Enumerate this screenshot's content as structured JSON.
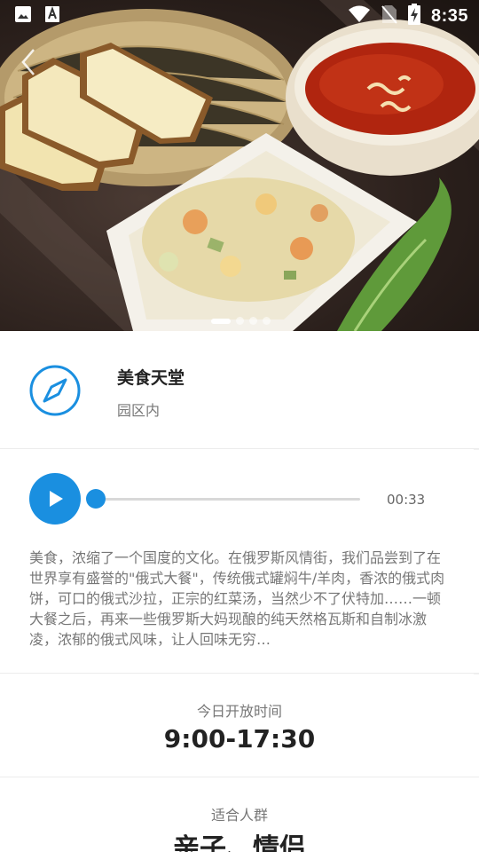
{
  "status_bar": {
    "time": "8:35",
    "icons": [
      "image-icon",
      "font-a-icon",
      "wifi-icon",
      "no-sim-icon",
      "battery-charging-icon"
    ]
  },
  "hero": {
    "image_description_icon": "food-photo",
    "carousel_pages": 4,
    "carousel_active": 0
  },
  "place": {
    "name": "美食天堂",
    "location": "园区内",
    "icon": "compass-icon"
  },
  "audio": {
    "duration": "00:33",
    "progress": 0.0,
    "accent": "#1a8fe0",
    "description": "美食，浓缩了一个国度的文化。在俄罗斯风情街，我们品尝到了在世界享有盛誉的\"俄式大餐\"，传统俄式罐焖牛/羊肉，香浓的俄式肉饼，可口的俄式沙拉，正宗的红菜汤，当然少不了伏特加……一顿大餐之后，再来一些俄罗斯大妈现酿的纯天然格瓦斯和自制冰激凌，浓郁的俄式风味，让人回味无穷…"
  },
  "hours": {
    "label": "今日开放时间",
    "value": "9:00-17:30"
  },
  "audience": {
    "label": "适合人群",
    "value": "亲子、情侣"
  }
}
